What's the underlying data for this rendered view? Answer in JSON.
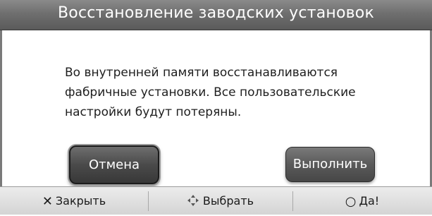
{
  "dialog": {
    "title": "Восстановление заводских установок",
    "message": "Во внутренней памяти восстанавливаются\nфабричные установки. Все пользовательские\nнастройки будут потеряны."
  },
  "buttons": {
    "cancel_label": "Отмена",
    "execute_label": "Выполнить"
  },
  "footer": {
    "close": {
      "icon": "close-x-icon",
      "label": "Закрыть"
    },
    "select": {
      "icon": "direction-arrows-icon",
      "label": "Выбрать"
    },
    "confirm": {
      "icon": "circle-ok-icon",
      "label": "Да!"
    }
  }
}
